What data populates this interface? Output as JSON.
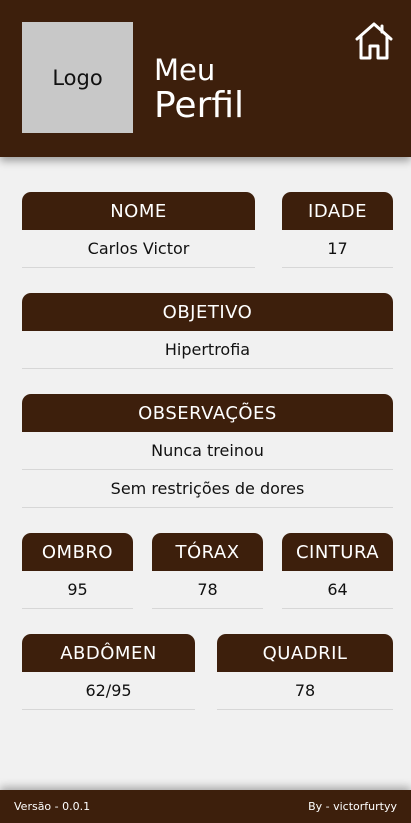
{
  "header": {
    "logo_text": "Logo",
    "title_line1": "Meu",
    "title_line2": "Perfil",
    "home_icon": "home-icon"
  },
  "profile": {
    "nome": {
      "label": "NOME",
      "value": "Carlos Victor"
    },
    "idade": {
      "label": "IDADE",
      "value": "17"
    },
    "objetivo": {
      "label": "OBJETIVO",
      "value": "Hipertrofia"
    },
    "observacoes": {
      "label": "OBSERVAÇÕES",
      "values": [
        "Nunca treinou",
        "Sem restrições de dores"
      ]
    }
  },
  "measurements": {
    "ombro": {
      "label": "OMBRO",
      "value": "95"
    },
    "torax": {
      "label": "TÓRAX",
      "value": "78"
    },
    "cintura": {
      "label": "CINTURA",
      "value": "64"
    },
    "abdomen": {
      "label": "ABDÔMEN",
      "value": "62/95"
    },
    "quadril": {
      "label": "QUADRIL",
      "value": "78"
    }
  },
  "footer": {
    "version": "Versão - 0.0.1",
    "author": "By - victorfurtyy"
  },
  "colors": {
    "brand_brown": "#3d1f0c",
    "background": "#f1f1f1",
    "logo_placeholder": "#c8c8c8"
  }
}
